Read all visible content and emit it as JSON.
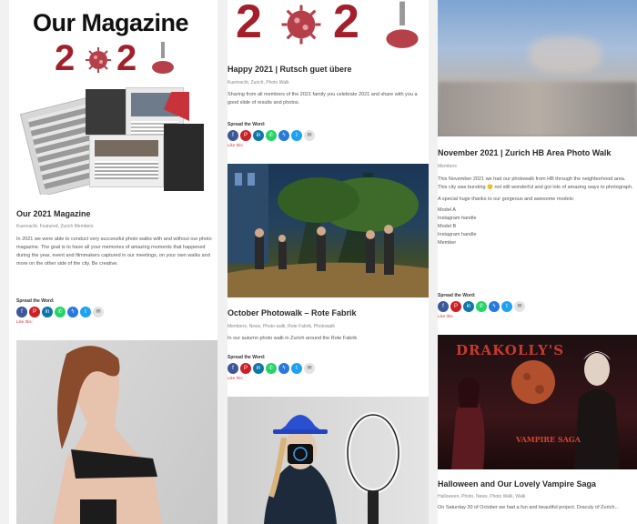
{
  "colors": {
    "brand_red": "#a3202a",
    "facebook": "#3b5998",
    "pinterest": "#cb2027",
    "linkedin": "#0e76a8",
    "whatsapp": "#25d366",
    "messenger": "#2779de",
    "twitter": "#1da1f2",
    "link_red": "#d03a3a"
  },
  "share": {
    "label": "Spread the Word:",
    "icons": [
      "facebook-icon",
      "pinterest-icon",
      "linkedin-icon",
      "whatsapp-icon",
      "messenger-icon",
      "twitter-icon",
      "mail-icon"
    ],
    "more_link": "Like this:"
  },
  "col1": {
    "logo_title": "Our Magazine",
    "logo_year_left": "2",
    "logo_year_mid": "2",
    "post": {
      "title": "Our 2021 Magazine",
      "meta": "Kuernacht, Featured, Zurich Members",
      "excerpt": "In 2021 we were able to conduct very successful photo walks with and without our photo magazine. The goal is to have all your memories of amazing moments that happened during the year, event and filmmakers captured in our meetings, on your own walks and more on the other side of the city. Be creative."
    }
  },
  "col2": {
    "post1": {
      "title": "Happy 2021 | Rutsch guet übere",
      "meta": "Kuernacht, Zurich, Photo Walk",
      "excerpt": "Sharing from all members of the 2021 family you celebrate 2021 and share with you a good slide of results and photos."
    },
    "post2": {
      "title": "October Photowalk – Rote Fabrik",
      "meta": "Members, News, Photo walk, Rote Fabrik, Photowalk",
      "excerpt": "In our autumn photo walk in Zurich around the Rote Fabrik"
    }
  },
  "col3": {
    "post1": {
      "title": "November 2021 | Zurich HB Area Photo Walk",
      "meta": "Members",
      "excerpt": "This November 2021 we had our photowalk from HB through the neighborhood area. This city was bursting 🙂 not still wonderful and got lots of amazing ways to photograph.",
      "excerpt2": "A special huge thanks to our gorgeous and awesome models:",
      "list": [
        "Model A",
        "Instagram handle",
        "Model B",
        "Instagram handle",
        "Member"
      ]
    },
    "post2": {
      "title": "Halloween and Our Lovely Vampire Saga",
      "meta": "Halloween, Photo, News, Photo Walk, Walk",
      "excerpt": "On Saturday 30 of October we had a fun and beautiful project. Draculy of Zurich..."
    },
    "poster_title": "DRAKOLLY'S",
    "poster_subtitle": "VAMPIRE SAGA"
  }
}
